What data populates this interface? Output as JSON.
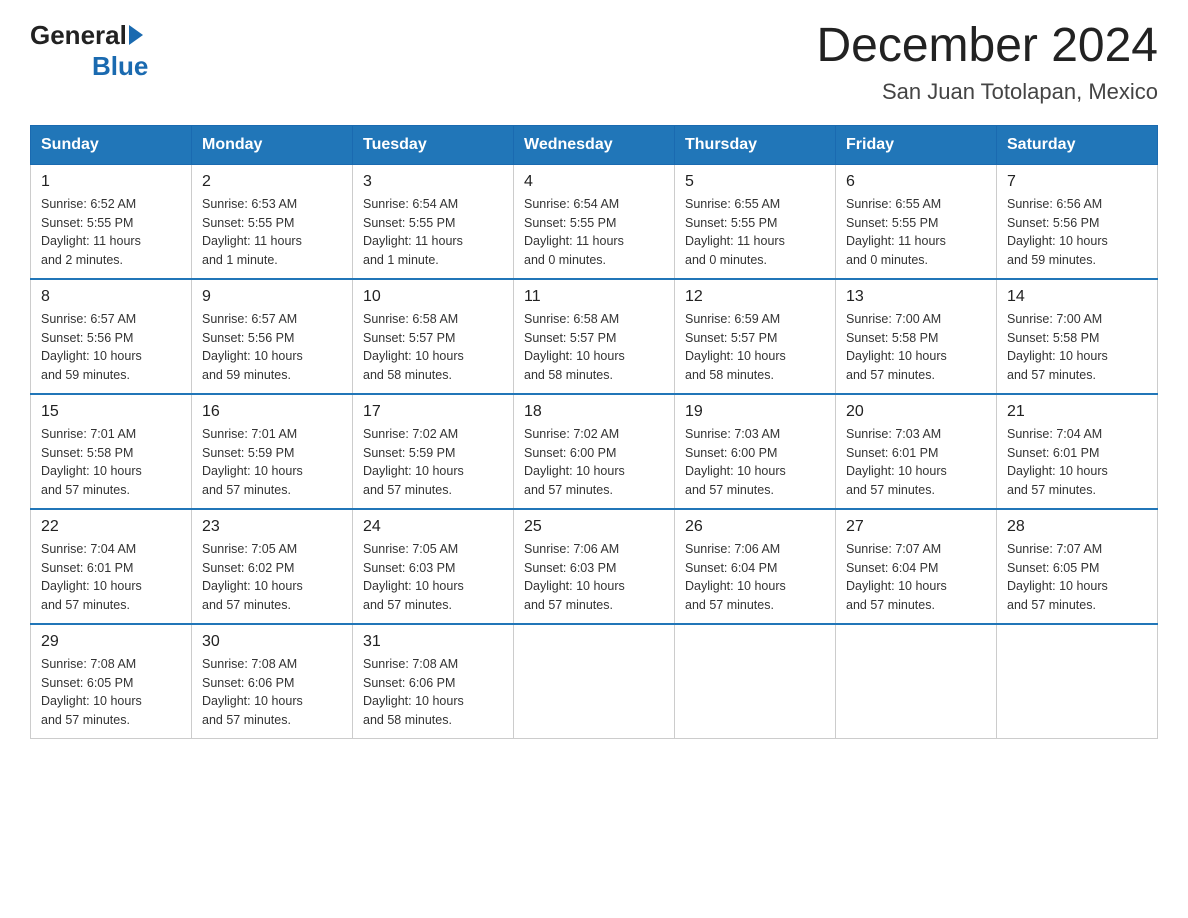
{
  "header": {
    "logo_general": "General",
    "logo_blue": "Blue",
    "title": "December 2024",
    "subtitle": "San Juan Totolapan, Mexico"
  },
  "days_of_week": [
    "Sunday",
    "Monday",
    "Tuesday",
    "Wednesday",
    "Thursday",
    "Friday",
    "Saturday"
  ],
  "weeks": [
    [
      {
        "day": "1",
        "info": "Sunrise: 6:52 AM\nSunset: 5:55 PM\nDaylight: 11 hours\nand 2 minutes."
      },
      {
        "day": "2",
        "info": "Sunrise: 6:53 AM\nSunset: 5:55 PM\nDaylight: 11 hours\nand 1 minute."
      },
      {
        "day": "3",
        "info": "Sunrise: 6:54 AM\nSunset: 5:55 PM\nDaylight: 11 hours\nand 1 minute."
      },
      {
        "day": "4",
        "info": "Sunrise: 6:54 AM\nSunset: 5:55 PM\nDaylight: 11 hours\nand 0 minutes."
      },
      {
        "day": "5",
        "info": "Sunrise: 6:55 AM\nSunset: 5:55 PM\nDaylight: 11 hours\nand 0 minutes."
      },
      {
        "day": "6",
        "info": "Sunrise: 6:55 AM\nSunset: 5:55 PM\nDaylight: 11 hours\nand 0 minutes."
      },
      {
        "day": "7",
        "info": "Sunrise: 6:56 AM\nSunset: 5:56 PM\nDaylight: 10 hours\nand 59 minutes."
      }
    ],
    [
      {
        "day": "8",
        "info": "Sunrise: 6:57 AM\nSunset: 5:56 PM\nDaylight: 10 hours\nand 59 minutes."
      },
      {
        "day": "9",
        "info": "Sunrise: 6:57 AM\nSunset: 5:56 PM\nDaylight: 10 hours\nand 59 minutes."
      },
      {
        "day": "10",
        "info": "Sunrise: 6:58 AM\nSunset: 5:57 PM\nDaylight: 10 hours\nand 58 minutes."
      },
      {
        "day": "11",
        "info": "Sunrise: 6:58 AM\nSunset: 5:57 PM\nDaylight: 10 hours\nand 58 minutes."
      },
      {
        "day": "12",
        "info": "Sunrise: 6:59 AM\nSunset: 5:57 PM\nDaylight: 10 hours\nand 58 minutes."
      },
      {
        "day": "13",
        "info": "Sunrise: 7:00 AM\nSunset: 5:58 PM\nDaylight: 10 hours\nand 57 minutes."
      },
      {
        "day": "14",
        "info": "Sunrise: 7:00 AM\nSunset: 5:58 PM\nDaylight: 10 hours\nand 57 minutes."
      }
    ],
    [
      {
        "day": "15",
        "info": "Sunrise: 7:01 AM\nSunset: 5:58 PM\nDaylight: 10 hours\nand 57 minutes."
      },
      {
        "day": "16",
        "info": "Sunrise: 7:01 AM\nSunset: 5:59 PM\nDaylight: 10 hours\nand 57 minutes."
      },
      {
        "day": "17",
        "info": "Sunrise: 7:02 AM\nSunset: 5:59 PM\nDaylight: 10 hours\nand 57 minutes."
      },
      {
        "day": "18",
        "info": "Sunrise: 7:02 AM\nSunset: 6:00 PM\nDaylight: 10 hours\nand 57 minutes."
      },
      {
        "day": "19",
        "info": "Sunrise: 7:03 AM\nSunset: 6:00 PM\nDaylight: 10 hours\nand 57 minutes."
      },
      {
        "day": "20",
        "info": "Sunrise: 7:03 AM\nSunset: 6:01 PM\nDaylight: 10 hours\nand 57 minutes."
      },
      {
        "day": "21",
        "info": "Sunrise: 7:04 AM\nSunset: 6:01 PM\nDaylight: 10 hours\nand 57 minutes."
      }
    ],
    [
      {
        "day": "22",
        "info": "Sunrise: 7:04 AM\nSunset: 6:01 PM\nDaylight: 10 hours\nand 57 minutes."
      },
      {
        "day": "23",
        "info": "Sunrise: 7:05 AM\nSunset: 6:02 PM\nDaylight: 10 hours\nand 57 minutes."
      },
      {
        "day": "24",
        "info": "Sunrise: 7:05 AM\nSunset: 6:03 PM\nDaylight: 10 hours\nand 57 minutes."
      },
      {
        "day": "25",
        "info": "Sunrise: 7:06 AM\nSunset: 6:03 PM\nDaylight: 10 hours\nand 57 minutes."
      },
      {
        "day": "26",
        "info": "Sunrise: 7:06 AM\nSunset: 6:04 PM\nDaylight: 10 hours\nand 57 minutes."
      },
      {
        "day": "27",
        "info": "Sunrise: 7:07 AM\nSunset: 6:04 PM\nDaylight: 10 hours\nand 57 minutes."
      },
      {
        "day": "28",
        "info": "Sunrise: 7:07 AM\nSunset: 6:05 PM\nDaylight: 10 hours\nand 57 minutes."
      }
    ],
    [
      {
        "day": "29",
        "info": "Sunrise: 7:08 AM\nSunset: 6:05 PM\nDaylight: 10 hours\nand 57 minutes."
      },
      {
        "day": "30",
        "info": "Sunrise: 7:08 AM\nSunset: 6:06 PM\nDaylight: 10 hours\nand 57 minutes."
      },
      {
        "day": "31",
        "info": "Sunrise: 7:08 AM\nSunset: 6:06 PM\nDaylight: 10 hours\nand 58 minutes."
      },
      {
        "day": "",
        "info": ""
      },
      {
        "day": "",
        "info": ""
      },
      {
        "day": "",
        "info": ""
      },
      {
        "day": "",
        "info": ""
      }
    ]
  ]
}
